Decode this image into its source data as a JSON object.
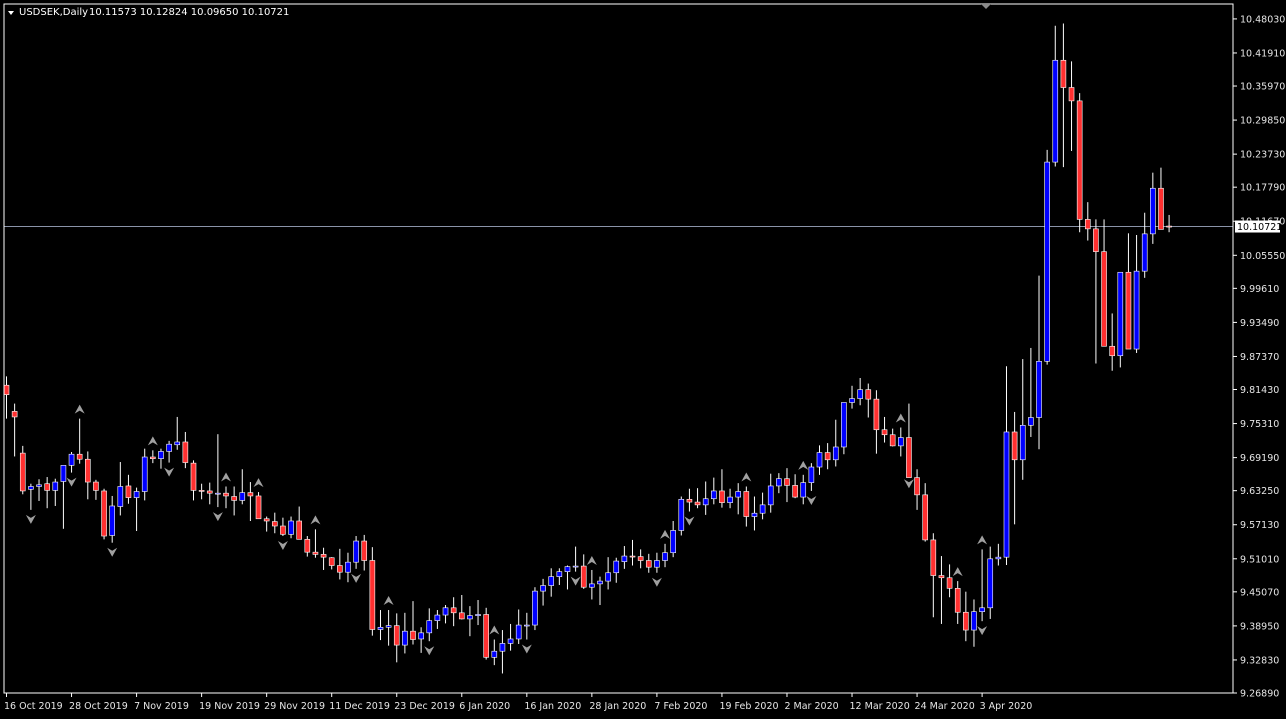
{
  "chart_header": {
    "symbol_label": "USDSEK,Daily",
    "ohlc_label": "10.11573 10.12824 10.09650 10.10721"
  },
  "colors": {
    "background": "#000000",
    "frame": "#ffffff",
    "bull_body": "#0000ff",
    "bear_body": "#ff3030",
    "wick": "#ffffff",
    "fractal": "#a0a0a0",
    "price_line": "#8a93a8",
    "price_badge": "#ffffff"
  },
  "chart_data": {
    "type": "candlestick",
    "symbol": "USDSEK",
    "timeframe": "Daily",
    "current_price": "10.10721",
    "price_axis_labels": [
      "10.48030",
      "10.41910",
      "10.35970",
      "10.29850",
      "10.23730",
      "10.17790",
      "10.11670",
      "10.05550",
      "9.99610",
      "9.93490",
      "9.87370",
      "9.81430",
      "9.75310",
      "9.69190",
      "9.63250",
      "9.57130",
      "9.51010",
      "9.45070",
      "9.38950",
      "9.32830",
      "9.26890"
    ],
    "ylim": [
      9.2689,
      10.5071
    ],
    "date_axis_labels": [
      "16 Oct 2019",
      "28 Oct 2019",
      "7 Nov 2019",
      "19 Nov 2019",
      "29 Nov 2019",
      "11 Dec 2019",
      "23 Dec 2019",
      "6 Jan 2020",
      "16 Jan 2020",
      "28 Jan 2020",
      "7 Feb 2020",
      "19 Feb 2020",
      "2 Mar 2020",
      "12 Mar 2020",
      "24 Mar 2020",
      "3 Apr 2020"
    ],
    "date_axis_label_candle_index": [
      0,
      8,
      16,
      24,
      32,
      40,
      48,
      56,
      64,
      72,
      80,
      88,
      96,
      104,
      112,
      120
    ],
    "ohlc": [
      [
        9.822,
        9.838,
        9.762,
        9.805
      ],
      [
        9.775,
        9.789,
        9.694,
        9.765
      ],
      [
        9.7,
        9.713,
        9.626,
        9.632
      ],
      [
        9.635,
        9.645,
        9.598,
        9.64
      ],
      [
        9.64,
        9.653,
        9.614,
        9.643
      ],
      [
        9.645,
        9.657,
        9.601,
        9.633
      ],
      [
        9.633,
        9.654,
        9.605,
        9.648
      ],
      [
        9.649,
        9.677,
        9.564,
        9.678
      ],
      [
        9.678,
        9.702,
        9.665,
        9.698
      ],
      [
        9.698,
        9.762,
        9.681,
        9.689
      ],
      [
        9.689,
        9.703,
        9.617,
        9.648
      ],
      [
        9.648,
        9.652,
        9.616,
        9.633
      ],
      [
        9.632,
        9.636,
        9.545,
        9.551
      ],
      [
        9.552,
        9.623,
        9.539,
        9.605
      ],
      [
        9.604,
        9.684,
        9.588,
        9.64
      ],
      [
        9.641,
        9.661,
        9.609,
        9.62
      ],
      [
        9.62,
        9.638,
        9.56,
        9.631
      ],
      [
        9.631,
        9.708,
        9.615,
        9.693
      ],
      [
        9.693,
        9.705,
        9.682,
        9.69
      ],
      [
        9.69,
        9.708,
        9.672,
        9.703
      ],
      [
        9.703,
        9.722,
        9.683,
        9.716
      ],
      [
        9.715,
        9.765,
        9.706,
        9.72
      ],
      [
        9.72,
        9.738,
        9.673,
        9.683
      ],
      [
        9.682,
        9.687,
        9.615,
        9.633
      ],
      [
        9.633,
        9.645,
        9.617,
        9.632
      ],
      [
        9.632,
        9.647,
        9.608,
        9.628
      ],
      [
        9.628,
        9.734,
        9.603,
        9.628
      ],
      [
        9.628,
        9.64,
        9.601,
        9.623
      ],
      [
        9.622,
        9.64,
        9.588,
        9.615
      ],
      [
        9.615,
        9.671,
        9.608,
        9.629
      ],
      [
        9.629,
        9.648,
        9.578,
        9.623
      ],
      [
        9.623,
        9.63,
        9.585,
        9.582
      ],
      [
        9.582,
        9.586,
        9.559,
        9.578
      ],
      [
        9.577,
        9.593,
        9.556,
        9.569
      ],
      [
        9.569,
        9.584,
        9.551,
        9.554
      ],
      [
        9.554,
        9.586,
        9.547,
        9.578
      ],
      [
        9.578,
        9.604,
        9.559,
        9.545
      ],
      [
        9.545,
        9.551,
        9.514,
        9.522
      ],
      [
        9.522,
        9.563,
        9.512,
        9.518
      ],
      [
        9.518,
        9.53,
        9.49,
        9.513
      ],
      [
        9.512,
        9.513,
        9.491,
        9.498
      ],
      [
        9.498,
        9.528,
        9.473,
        9.486
      ],
      [
        9.486,
        9.521,
        9.468,
        9.504
      ],
      [
        9.504,
        9.551,
        9.492,
        9.542
      ],
      [
        9.542,
        9.553,
        9.489,
        9.507
      ],
      [
        9.507,
        9.531,
        9.372,
        9.383
      ],
      [
        9.383,
        9.418,
        9.364,
        9.387
      ],
      [
        9.387,
        9.418,
        9.354,
        9.39
      ],
      [
        9.39,
        9.412,
        9.324,
        9.355
      ],
      [
        9.355,
        9.413,
        9.34,
        9.38
      ],
      [
        9.38,
        9.434,
        9.356,
        9.365
      ],
      [
        9.366,
        9.387,
        9.341,
        9.377
      ],
      [
        9.377,
        9.421,
        9.362,
        9.399
      ],
      [
        9.399,
        9.418,
        9.384,
        9.409
      ],
      [
        9.409,
        9.427,
        9.394,
        9.422
      ],
      [
        9.422,
        9.441,
        9.389,
        9.413
      ],
      [
        9.413,
        9.445,
        9.401,
        9.402
      ],
      [
        9.402,
        9.425,
        9.371,
        9.408
      ],
      [
        9.408,
        9.436,
        9.391,
        9.41
      ],
      [
        9.41,
        9.422,
        9.329,
        9.333
      ],
      [
        9.333,
        9.365,
        9.319,
        9.344
      ],
      [
        9.344,
        9.382,
        9.304,
        9.358
      ],
      [
        9.358,
        9.393,
        9.345,
        9.366
      ],
      [
        9.366,
        9.419,
        9.357,
        9.391
      ],
      [
        9.391,
        9.413,
        9.365,
        9.391
      ],
      [
        9.391,
        9.459,
        9.382,
        9.452
      ],
      [
        9.452,
        9.474,
        9.426,
        9.462
      ],
      [
        9.462,
        9.493,
        9.442,
        9.478
      ],
      [
        9.478,
        9.493,
        9.463,
        9.487
      ],
      [
        9.487,
        9.498,
        9.455,
        9.496
      ],
      [
        9.496,
        9.532,
        9.487,
        9.497
      ],
      [
        9.497,
        9.518,
        9.456,
        9.459
      ],
      [
        9.459,
        9.49,
        9.437,
        9.465
      ],
      [
        9.465,
        9.478,
        9.427,
        9.47
      ],
      [
        9.47,
        9.513,
        9.455,
        9.485
      ],
      [
        9.485,
        9.512,
        9.467,
        9.506
      ],
      [
        9.505,
        9.533,
        9.492,
        9.515
      ],
      [
        9.515,
        9.544,
        9.498,
        9.514
      ],
      [
        9.514,
        9.527,
        9.493,
        9.507
      ],
      [
        9.507,
        9.519,
        9.485,
        9.495
      ],
      [
        9.495,
        9.521,
        9.485,
        9.507
      ],
      [
        9.507,
        9.537,
        9.495,
        9.521
      ],
      [
        9.521,
        9.578,
        9.513,
        9.561
      ],
      [
        9.561,
        9.622,
        9.552,
        9.617
      ],
      [
        9.617,
        9.636,
        9.595,
        9.612
      ],
      [
        9.612,
        9.637,
        9.601,
        9.607
      ],
      [
        9.607,
        9.649,
        9.589,
        9.618
      ],
      [
        9.618,
        9.656,
        9.608,
        9.632
      ],
      [
        9.632,
        9.671,
        9.602,
        9.611
      ],
      [
        9.611,
        9.636,
        9.601,
        9.621
      ],
      [
        9.621,
        9.646,
        9.59,
        9.631
      ],
      [
        9.631,
        9.64,
        9.568,
        9.586
      ],
      [
        9.586,
        9.622,
        9.561,
        9.592
      ],
      [
        9.592,
        9.629,
        9.581,
        9.607
      ],
      [
        9.607,
        9.663,
        9.593,
        9.641
      ],
      [
        9.641,
        9.664,
        9.628,
        9.654
      ],
      [
        9.654,
        9.673,
        9.612,
        9.642
      ],
      [
        9.642,
        9.662,
        9.619,
        9.621
      ],
      [
        9.621,
        9.661,
        9.608,
        9.647
      ],
      [
        9.647,
        9.682,
        9.632,
        9.675
      ],
      [
        9.675,
        9.714,
        9.661,
        9.701
      ],
      [
        9.701,
        9.718,
        9.671,
        9.688
      ],
      [
        9.688,
        9.76,
        9.676,
        9.711
      ],
      [
        9.711,
        9.781,
        9.698,
        9.791
      ],
      [
        9.791,
        9.821,
        9.78,
        9.798
      ],
      [
        9.798,
        9.835,
        9.786,
        9.814
      ],
      [
        9.814,
        9.825,
        9.764,
        9.797
      ],
      [
        9.797,
        9.813,
        9.699,
        9.742
      ],
      [
        9.742,
        9.765,
        9.719,
        9.733
      ],
      [
        9.733,
        9.744,
        9.712,
        9.713
      ],
      [
        9.713,
        9.746,
        9.694,
        9.728
      ],
      [
        9.728,
        9.789,
        9.662,
        9.656
      ],
      [
        9.656,
        9.671,
        9.598,
        9.625
      ],
      [
        9.625,
        9.646,
        9.541,
        9.544
      ],
      [
        9.544,
        9.556,
        9.405,
        9.48
      ],
      [
        9.48,
        9.515,
        9.393,
        9.476
      ],
      [
        9.476,
        9.5,
        9.441,
        9.457
      ],
      [
        9.457,
        9.47,
        9.393,
        9.414
      ],
      [
        9.414,
        9.451,
        9.362,
        9.382
      ],
      [
        9.382,
        9.437,
        9.352,
        9.415
      ],
      [
        9.415,
        9.527,
        9.398,
        9.422
      ],
      [
        9.422,
        9.532,
        9.402,
        9.51
      ],
      [
        9.51,
        9.537,
        9.498,
        9.513
      ],
      [
        9.513,
        9.856,
        9.499,
        9.738
      ],
      [
        9.738,
        9.774,
        9.572,
        9.688
      ],
      [
        9.688,
        9.869,
        9.652,
        9.75
      ],
      [
        9.75,
        9.889,
        9.729,
        9.764
      ],
      [
        9.764,
        10.019,
        9.707,
        9.865
      ],
      [
        9.865,
        10.245,
        9.859,
        10.223
      ],
      [
        10.223,
        10.468,
        10.215,
        10.406
      ],
      [
        10.406,
        10.472,
        10.214,
        10.357
      ],
      [
        10.357,
        10.404,
        10.243,
        10.333
      ],
      [
        10.333,
        10.347,
        10.097,
        10.12
      ],
      [
        10.12,
        10.151,
        10.082,
        10.103
      ],
      [
        10.103,
        10.12,
        9.861,
        10.062
      ],
      [
        10.062,
        10.12,
        9.918,
        9.892
      ],
      [
        9.892,
        9.951,
        9.848,
        9.875
      ],
      [
        9.875,
        9.918,
        9.854,
        10.025
      ],
      [
        10.025,
        10.095,
        9.908,
        9.887
      ],
      [
        9.887,
        10.092,
        9.88,
        10.027
      ],
      [
        10.027,
        10.132,
        10.015,
        10.094
      ],
      [
        10.094,
        10.204,
        10.076,
        10.176
      ],
      [
        10.176,
        10.213,
        10.154,
        10.102
      ],
      [
        10.108,
        10.128,
        10.097,
        10.107
      ]
    ],
    "fractals_up_index": [
      9,
      18,
      27,
      31,
      38,
      47,
      60,
      72,
      81,
      91,
      98,
      110,
      117,
      120
    ],
    "fractals_down_index": [
      3,
      8,
      13,
      20,
      26,
      34,
      43,
      52,
      64,
      70,
      80,
      84,
      99,
      111,
      120
    ]
  }
}
